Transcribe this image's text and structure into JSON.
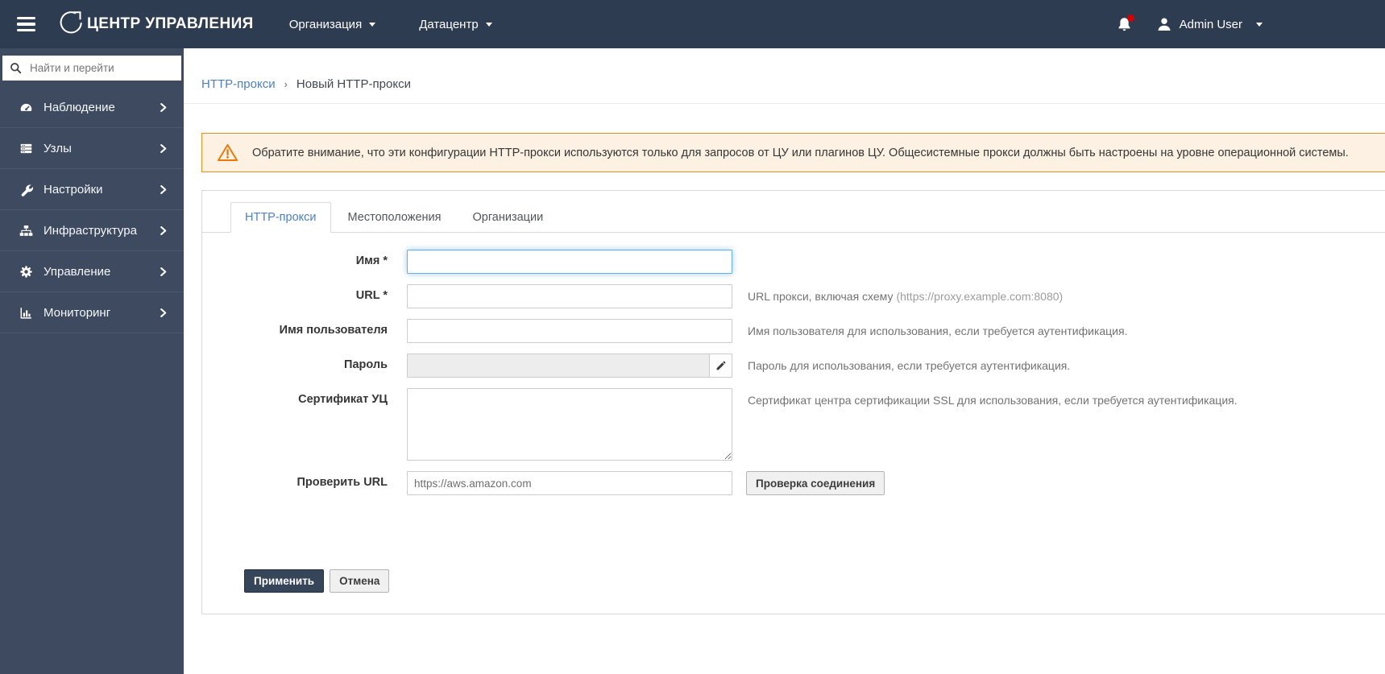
{
  "topbar": {
    "brand": "ЦЕНТР УПРАВЛЕНИЯ",
    "org_menu": "Организация",
    "location_menu": "Датацентр",
    "user_name": "Admin User"
  },
  "sidebar": {
    "search_placeholder": "Найти и перейти",
    "items": [
      {
        "label": "Наблюдение",
        "icon": "gauge-icon"
      },
      {
        "label": "Узлы",
        "icon": "server-icon"
      },
      {
        "label": "Настройки",
        "icon": "wrench-icon"
      },
      {
        "label": "Инфраструктура",
        "icon": "sitemap-icon"
      },
      {
        "label": "Управление",
        "icon": "gear-icon"
      },
      {
        "label": "Мониторинг",
        "icon": "bar-chart-icon"
      }
    ]
  },
  "breadcrumb": {
    "link": "HTTP-прокси",
    "separator": "›",
    "current": "Новый HTTP-прокси"
  },
  "alert": {
    "text": "Обратите внимание, что эти конфигурации HTTP-прокси используются только для запросов от ЦУ или плагинов ЦУ. Общесистемные прокси должны быть настроены на уровне операционной системы."
  },
  "tabs": [
    {
      "label": "HTTP-прокси",
      "active": true
    },
    {
      "label": "Местоположения",
      "active": false
    },
    {
      "label": "Организации",
      "active": false
    }
  ],
  "form": {
    "name": {
      "label": "Имя *",
      "value": ""
    },
    "url": {
      "label": "URL *",
      "value": "",
      "help": "URL прокси, включая схему",
      "help_example": "(https://proxy.example.com:8080)"
    },
    "username": {
      "label": "Имя пользователя",
      "value": "",
      "help": "Имя пользователя для использования, если требуется аутентификация."
    },
    "password": {
      "label": "Пароль",
      "value": "",
      "help": "Пароль для использования, если требуется аутентификация."
    },
    "cacert": {
      "label": "Сертификат УЦ",
      "value": "",
      "help": "Сертификат центра сертификации SSL для использования, если требуется аутентификация."
    },
    "testurl": {
      "label": "Проверить URL",
      "value": "https://aws.amazon.com",
      "button": "Проверка соединения"
    },
    "submit_label": "Применить",
    "cancel_label": "Отмена"
  },
  "colors": {
    "topbar_bg": "#2e3c51",
    "sidebar_bg": "#3d4a5f",
    "link_blue": "#4f7fbc",
    "alert_bg": "#fcf1e2",
    "alert_border": "#e0921f",
    "alert_icon_orange": "#ec7a08",
    "primary_button_bg": "#36455a",
    "notification_badge_red": "#d40000",
    "focus_ring_blue": "#66afe9"
  }
}
